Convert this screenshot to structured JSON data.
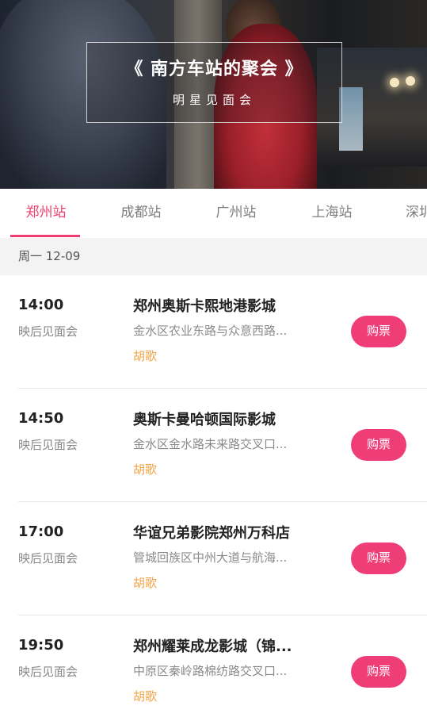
{
  "banner": {
    "title": "《 南方车站的聚会 》",
    "subtitle": "明星见面会"
  },
  "tabs": [
    {
      "label": "郑州站",
      "active": true
    },
    {
      "label": "成都站",
      "active": false
    },
    {
      "label": "广州站",
      "active": false
    },
    {
      "label": "上海站",
      "active": false
    },
    {
      "label": "深圳站",
      "active": false
    }
  ],
  "date_bar": "周一 12-09",
  "rows": [
    {
      "time": "14:00",
      "session": "映后见面会",
      "cinema": "郑州奥斯卡熙地港影城",
      "address": "金水区农业东路与众意西路...",
      "guest": "胡歌",
      "buy_label": "购票"
    },
    {
      "time": "14:50",
      "session": "映后见面会",
      "cinema": "奥斯卡曼哈顿国际影城",
      "address": "金水区金水路未来路交叉口...",
      "guest": "胡歌",
      "buy_label": "购票"
    },
    {
      "time": "17:00",
      "session": "映后见面会",
      "cinema": "华谊兄弟影院郑州万科店",
      "address": "管城回族区中州大道与航海...",
      "guest": "胡歌",
      "buy_label": "购票"
    },
    {
      "time": "19:50",
      "session": "映后见面会",
      "cinema": "郑州耀莱成龙影城（锦...",
      "address": "中原区秦岭路棉纺路交叉口...",
      "guest": "胡歌",
      "buy_label": "购票"
    }
  ],
  "colors": {
    "accent": "#ef3d6d",
    "button": "#ef3d77",
    "guest": "#f0a447"
  }
}
